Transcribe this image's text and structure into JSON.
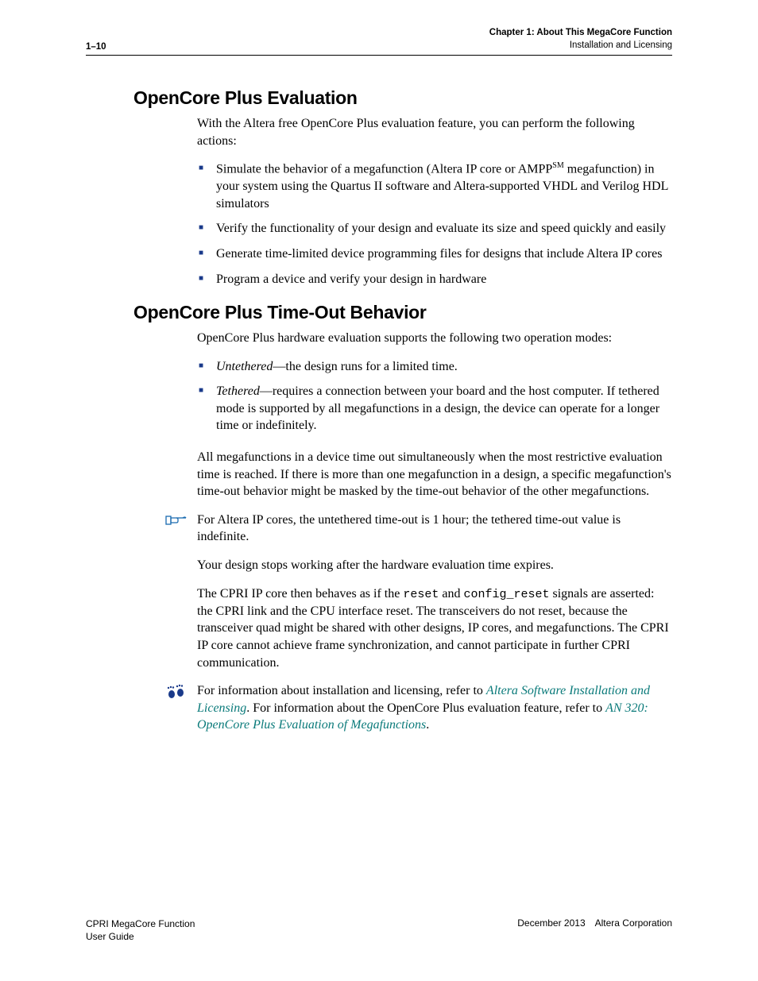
{
  "header": {
    "page_number": "1–10",
    "chapter_line": "Chapter 1: About This MegaCore Function",
    "section_line": "Installation and Licensing"
  },
  "section1": {
    "title": "OpenCore Plus Evaluation",
    "intro": "With the Altera free OpenCore Plus evaluation feature, you can perform the following actions:",
    "bullet1_a": "Simulate the behavior of a megafunction (Altera IP core or AMPP",
    "bullet1_sm": "SM",
    "bullet1_b": " megafunction) in your system using the Quartus II software and Altera-supported VHDL and Verilog HDL simulators",
    "bullet2": "Verify the functionality of your design and evaluate its size and speed quickly and easily",
    "bullet3": "Generate time-limited device programming files for designs that include Altera IP cores",
    "bullet4": "Program a device and verify your design in hardware"
  },
  "section2": {
    "title": "OpenCore Plus Time-Out Behavior",
    "intro": "OpenCore Plus hardware evaluation supports the following two operation modes:",
    "b1_term": "Untethered",
    "b1_rest": "—the design runs for a limited time.",
    "b2_term": "Tethered",
    "b2_rest": "—requires a connection between your board and the host computer. If tethered mode is supported by all megafunctions in a design, the device can operate for a longer time or indefinitely.",
    "para1": "All megafunctions in a device time out simultaneously when the most restrictive evaluation time is reached. If there is more than one megafunction in a design, a specific megafunction's time-out behavior might be masked by the time-out behavior of the other megafunctions.",
    "note1": "For Altera IP cores, the untethered time-out is 1 hour; the tethered time-out value is indefinite.",
    "para2": "Your design stops working after the hardware evaluation time expires.",
    "para3_a": "The CPRI IP core then behaves as if the ",
    "para3_code1": "reset",
    "para3_b": " and ",
    "para3_code2": "config_reset",
    "para3_c": " signals are asserted: the CPRI link and the CPU interface reset. The transceivers do not reset, because the transceiver quad might be shared with other designs, IP cores, and megafunctions. The CPRI IP core cannot achieve frame synchronization, and cannot participate in further CPRI communication.",
    "note2_a": "For information about installation and licensing, refer to ",
    "note2_link1": "Altera Software Installation and Licensing",
    "note2_b": ". For information about the OpenCore Plus evaluation feature, refer to ",
    "note2_link2": "AN 320: OpenCore Plus Evaluation of Megafunctions",
    "note2_c": "."
  },
  "footer": {
    "left_line1": "CPRI MegaCore Function",
    "left_line2": "User Guide",
    "right": "December 2013 Altera Corporation"
  }
}
